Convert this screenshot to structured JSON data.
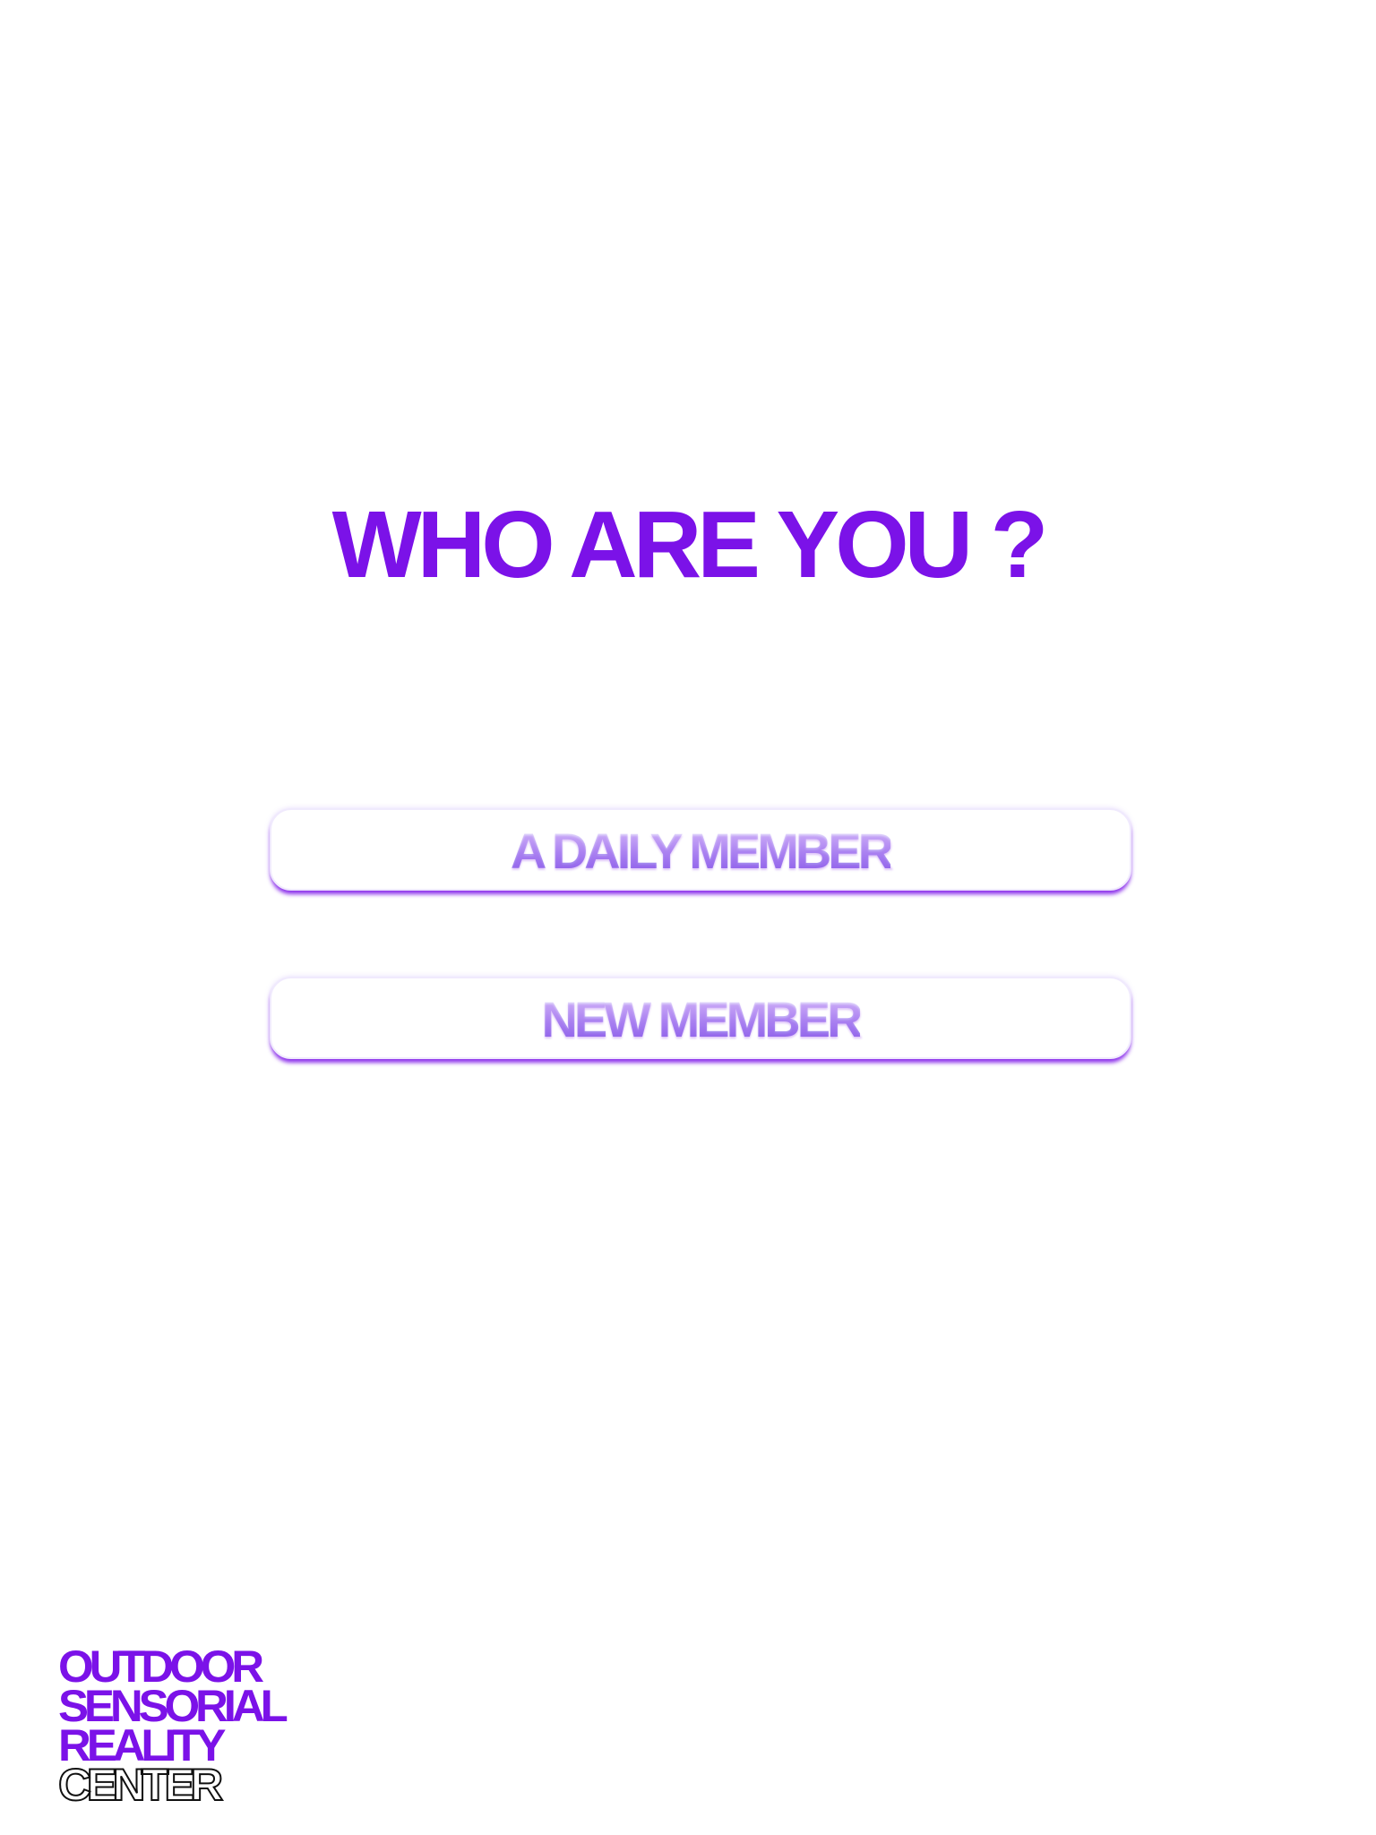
{
  "screen": {
    "heading": "WHO ARE YOU ?"
  },
  "options": {
    "daily_member": "A DAILY MEMBER",
    "new_member": "NEW MEMBER"
  },
  "logo": {
    "line1": "OUTDOOR",
    "line2": "SENSORIAL",
    "line3": "REALITY",
    "line4": "CENTER"
  },
  "colors": {
    "accent": "#7b12e8",
    "background": "#ffffff",
    "button_label_gradient": [
      "#f4efff",
      "#b8a3f4",
      "#8f73ea"
    ]
  }
}
